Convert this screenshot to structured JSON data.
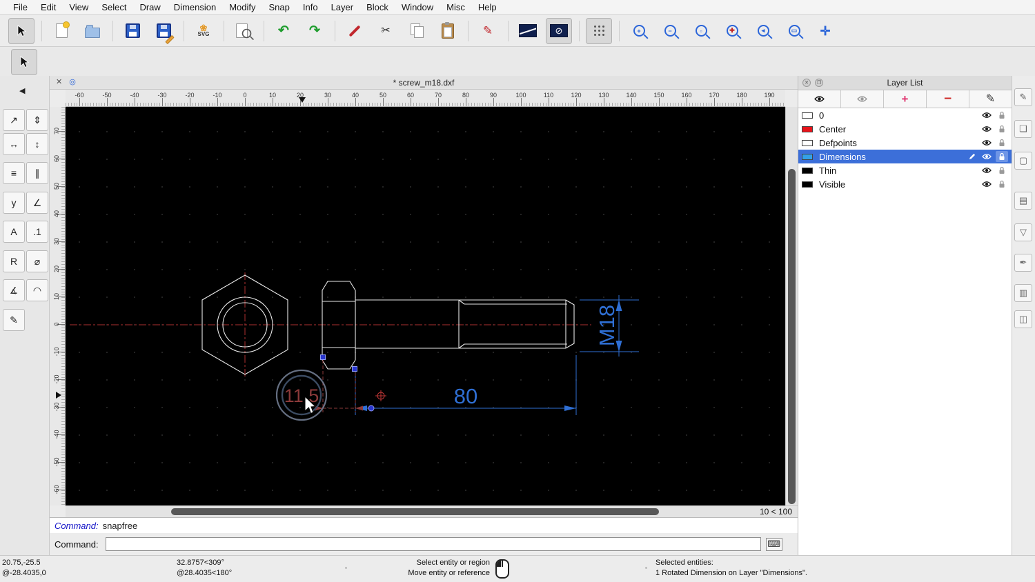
{
  "menu": {
    "items": [
      "File",
      "Edit",
      "View",
      "Select",
      "Draw",
      "Dimension",
      "Modify",
      "Snap",
      "Info",
      "Layer",
      "Block",
      "Window",
      "Misc",
      "Help"
    ]
  },
  "window": {
    "doc_title": "* screw_m18.dxf",
    "grid_indicator": "10 < 100"
  },
  "toolbar": {
    "svg_label": "SVG"
  },
  "rulers": {
    "horizontal": [
      "-60",
      "-50",
      "-40",
      "-30",
      "-20",
      "-10",
      "0",
      "10",
      "20",
      "30",
      "40",
      "50",
      "60",
      "70",
      "80",
      "90",
      "100",
      "110",
      "120",
      "130",
      "140",
      "150",
      "160",
      "170",
      "180",
      "190"
    ],
    "vertical": [
      "70",
      "60",
      "50",
      "40",
      "30",
      "20",
      "10",
      "0",
      "-10",
      "-20",
      "-30",
      "-40",
      "-50",
      "-60"
    ]
  },
  "left_tools": [
    {
      "name": "dim-aligned-icon",
      "glyph": "↗"
    },
    {
      "name": "dim-linear-icon",
      "glyph": "⇕"
    },
    {
      "name": "dim-horizontal-icon",
      "glyph": "↔"
    },
    {
      "name": "dim-vertical-icon",
      "glyph": "↕"
    },
    {
      "name": "dim-baseline-icon",
      "glyph": "≡"
    },
    {
      "name": "dim-continue-icon",
      "glyph": "∥"
    },
    {
      "name": "dim-ordinate-icon",
      "glyph": "y"
    },
    {
      "name": "dim-angular-icon",
      "glyph": "∠"
    },
    {
      "name": "dim-label-icon",
      "glyph": "A"
    },
    {
      "name": "dim-tolerance-icon",
      "glyph": ".1"
    },
    {
      "name": "dim-radial-icon",
      "glyph": "R"
    },
    {
      "name": "dim-diametric-icon",
      "glyph": "⌀"
    },
    {
      "name": "dim-angle-icon",
      "glyph": "∡"
    },
    {
      "name": "dim-arc-icon",
      "glyph": "◠"
    },
    {
      "name": "dim-leader-icon",
      "glyph": "✎"
    }
  ],
  "drawing": {
    "dim_length": "80",
    "dim_thread": "M18",
    "dim_moving": "11.5"
  },
  "layer_panel": {
    "title": "Layer List",
    "layers": [
      {
        "name": "0",
        "color": "#ffffff",
        "selected": false
      },
      {
        "name": "Center",
        "color": "#e8131a",
        "selected": false
      },
      {
        "name": "Defpoints",
        "color": "#ffffff",
        "selected": false
      },
      {
        "name": "Dimensions",
        "color": "#33a1e8",
        "selected": true
      },
      {
        "name": "Thin",
        "color": "#000000",
        "selected": false
      },
      {
        "name": "Visible",
        "color": "#000000",
        "selected": false
      }
    ]
  },
  "dock_icons": [
    {
      "name": "property-editor-panel-icon",
      "glyph": "✎"
    },
    {
      "name": "block-list-panel-icon",
      "glyph": "❏"
    },
    {
      "name": "library-browser-panel-icon",
      "glyph": "▢"
    },
    {
      "name": "command-widget-panel-icon",
      "glyph": "▤"
    },
    {
      "name": "layer-filter-panel-icon",
      "glyph": "▽"
    },
    {
      "name": "pen-palette-panel-icon",
      "glyph": "✒"
    },
    {
      "name": "matrix-panel-icon",
      "glyph": "▥"
    },
    {
      "name": "clipboard-panel-icon",
      "glyph": "◫"
    }
  ],
  "command": {
    "history_prompt": "Command:",
    "history_value": "snapfree",
    "input_label": "Command:",
    "input_value": ""
  },
  "status": {
    "abs_coord": "20.75,-25.5",
    "rel_coord": "@-28.4035,0",
    "abs_polar": "32.8757<309°",
    "rel_polar": "@28.4035<180°",
    "hint_line1": "Select entity or region",
    "hint_line2": "Move entity or reference",
    "selected_label": "Selected entities:",
    "selected_value": "1 Rotated Dimension on Layer \"Dimensions\"."
  },
  "colors": {
    "dimension_blue": "#2f6fd4",
    "dragging_red": "#8b3a3a",
    "selection_blue": "#3c6fd9",
    "centerline_red": "#ab3030"
  }
}
